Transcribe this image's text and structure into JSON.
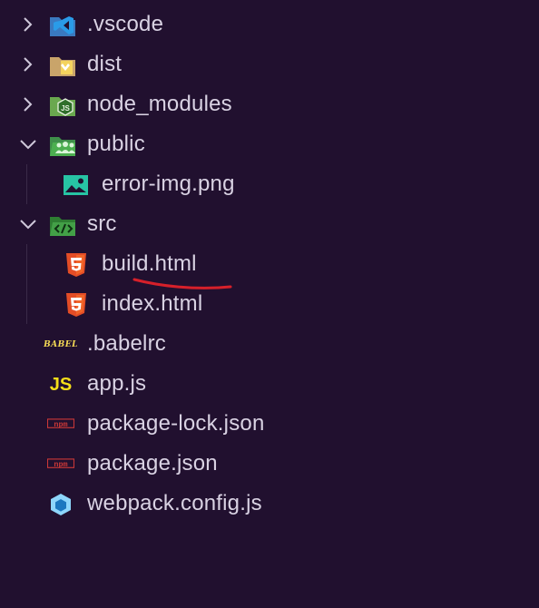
{
  "explorer": {
    "items": [
      {
        "label": ".vscode",
        "kind": "folder",
        "icon": "vscode-folder-icon",
        "expanded": false
      },
      {
        "label": "dist",
        "kind": "folder",
        "icon": "dist-folder-icon",
        "expanded": false
      },
      {
        "label": "node_modules",
        "kind": "folder",
        "icon": "node-modules-folder-icon",
        "expanded": false
      },
      {
        "label": "public",
        "kind": "folder",
        "icon": "public-folder-icon",
        "expanded": true
      },
      {
        "label": "error-img.png",
        "kind": "file",
        "icon": "image-file-icon"
      },
      {
        "label": "src",
        "kind": "folder",
        "icon": "src-folder-icon",
        "expanded": true
      },
      {
        "label": "build.html",
        "kind": "file",
        "icon": "html5-icon",
        "annotated": true
      },
      {
        "label": "index.html",
        "kind": "file",
        "icon": "html5-icon"
      },
      {
        "label": ".babelrc",
        "kind": "file",
        "icon": "babel-icon"
      },
      {
        "label": "app.js",
        "kind": "file",
        "icon": "js-icon"
      },
      {
        "label": "package-lock.json",
        "kind": "file",
        "icon": "npm-icon"
      },
      {
        "label": "package.json",
        "kind": "file",
        "icon": "npm-icon"
      },
      {
        "label": "webpack.config.js",
        "kind": "file",
        "icon": "webpack-icon"
      }
    ],
    "icon_text": {
      "babel": "BABEL",
      "js": "JS",
      "npm": "npm",
      "node": "JS"
    }
  },
  "colors": {
    "background": "#21102f",
    "text": "#d9d2e3",
    "annotation": "#d6202a"
  }
}
